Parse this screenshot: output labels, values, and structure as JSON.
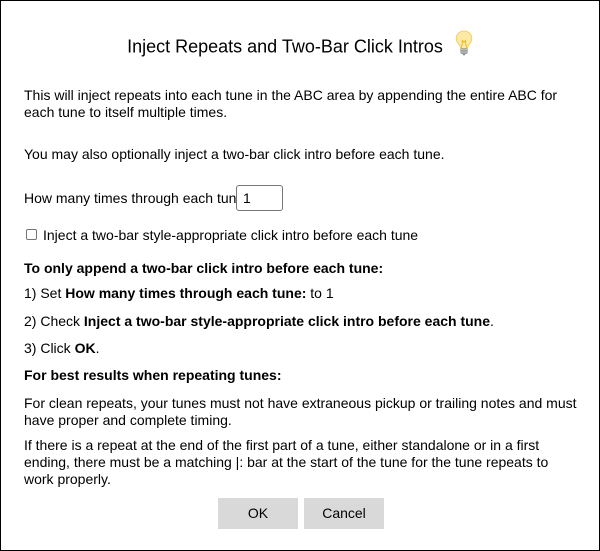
{
  "dialog": {
    "title": "Inject Repeats and Two-Bar Click Intros",
    "title_icon": "lightbulb-icon",
    "intro": "This will inject repeats into each tune in the ABC area by appending the entire ABC for each tune to itself multiple times.",
    "optional_note": "You may also optionally inject a two-bar click intro before each tune.",
    "times_label": "How many times through each tune:",
    "times_value": "1",
    "checkbox_label": "Inject a two-bar style-appropriate click intro before each tune",
    "checkbox_checked": false,
    "only_intro_heading": "To only append a two-bar click intro before each tune:",
    "step1_prefix": "1) Set ",
    "step1_bold": "How many times through each tune:",
    "step1_suffix": " to 1",
    "step2_prefix": "2) Check ",
    "step2_bold": "Inject a two-bar style-appropriate click intro before each tune",
    "step2_suffix": ".",
    "step3_prefix": "3) Click ",
    "step3_bold": "OK",
    "step3_suffix": ".",
    "best_results_heading": "For best results when repeating tunes:",
    "clean_repeats_note": "For clean repeats, your tunes must not have extraneous pickup or trailing notes and must have proper and complete timing.",
    "repeat_note": "If there is a repeat at the end of the first part of a tune, either standalone or in a first ending, there must be a matching |: bar at the start of the tune for the tune repeats to work properly."
  },
  "buttons": {
    "ok_label": "OK",
    "cancel_label": "Cancel"
  },
  "colors": {
    "button_bg": "#d9d9d9",
    "border": "#000000",
    "bulb_glass": "#fde9a6",
    "bulb_base": "#b9b9b9"
  }
}
